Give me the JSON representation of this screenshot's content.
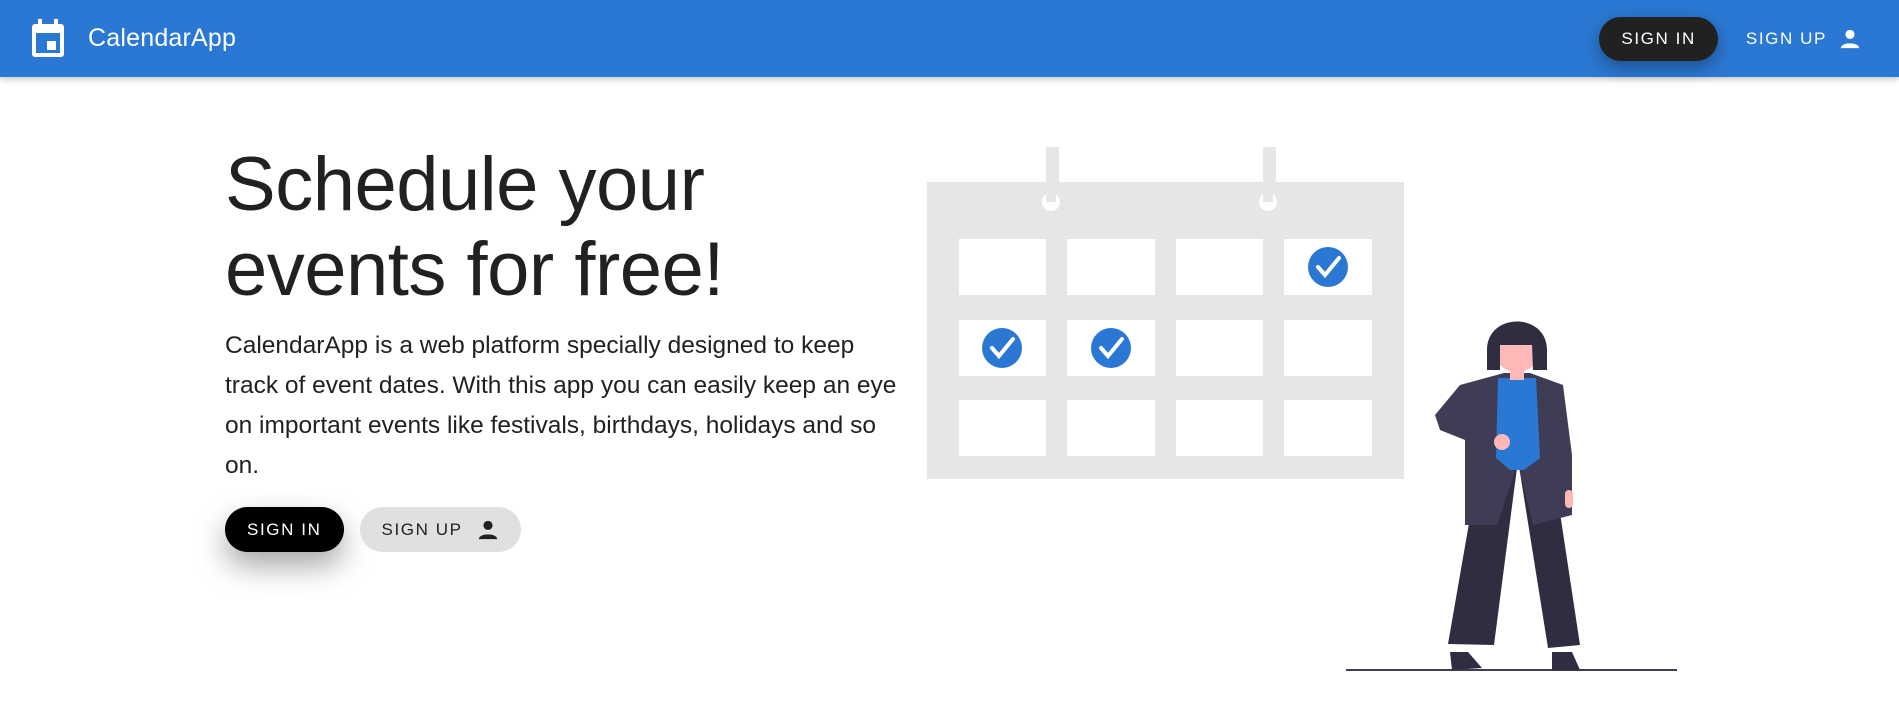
{
  "header": {
    "title": "CalendarApp",
    "sign_in_label": "SIGN IN",
    "sign_up_label": "SIGN UP",
    "logo_icon": "calendar-icon",
    "bg_color": "#2b78d4"
  },
  "hero": {
    "title_line1": "Schedule your",
    "title_line2": "events for free!",
    "description": "CalendarApp is a web platform specially designed to keep track of event dates. With this app you can easily keep an eye on important events like festivals, birthdays, holidays and so on.",
    "sign_in_label": "SIGN IN",
    "sign_up_label": "SIGN UP"
  },
  "illustration": {
    "icon": "calendar-illustration",
    "checked_cells": [
      "r1c4",
      "r2c1",
      "r2c2"
    ],
    "accent_color": "#2b78d4"
  }
}
